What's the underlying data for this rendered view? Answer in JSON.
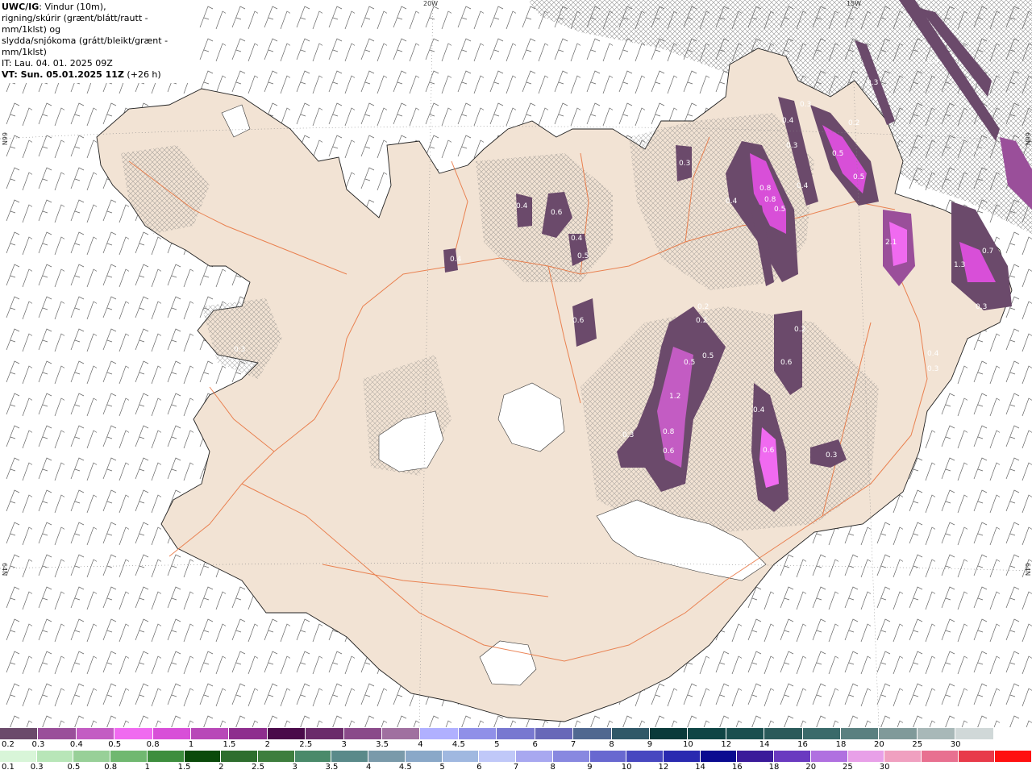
{
  "title": {
    "model": "UWC/IG",
    "line1_rest": ": Vindur (10m),",
    "line2": "rigning/skúrir (grænt/blátt/rautt - mm/1klst) og",
    "line3": "slydda/snjókoma (grátt/bleikt/grænt - mm/1klst)",
    "it": "IT: Lau. 04. 01. 2025 09Z",
    "vt_label": "VT: Sun. 05.01.2025 11Z",
    "vt_offset": " (+26 h)"
  },
  "coordinates": {
    "top_20w": "20W",
    "top_15w": "15W",
    "left_66n": "66N",
    "left_64n": "64N",
    "right_66n": "66N",
    "right_64n": "64N"
  },
  "snow_scale": {
    "colors": [
      "#6b4a6b",
      "#9a4f9a",
      "#c35cc3",
      "#f06af0",
      "#d84fd8",
      "#b848b8",
      "#8e2e8e",
      "#4a0a4a",
      "#6a2a6a",
      "#8a4a8a",
      "#a070a0",
      "#b0b0ff",
      "#9090e8",
      "#7878d0",
      "#6868b8",
      "#506890",
      "#305868",
      "#0a3a3a",
      "#0f4545",
      "#1a4f4f",
      "#2a5a5a",
      "#3a6a6a",
      "#5a8080",
      "#809a9a",
      "#a8b8b8",
      "#d0d8d8",
      "#ffffff"
    ],
    "labels": [
      "0.2",
      "0.3",
      "0.4",
      "0.5",
      "0.8",
      "1",
      "1.5",
      "2",
      "2.5",
      "3",
      "3.5",
      "4",
      "4.5",
      "5",
      "6",
      "7",
      "8",
      "9",
      "10",
      "12",
      "14",
      "16",
      "18",
      "20",
      "25",
      "30"
    ]
  },
  "rain_scale": {
    "colors": [
      "#d8f5d8",
      "#b8e6b8",
      "#98d098",
      "#70b870",
      "#3e8e3e",
      "#0a4a0a",
      "#2e6e2e",
      "#3e7e3e",
      "#4a8a6a",
      "#5a8a8a",
      "#7a9aaa",
      "#8aa8c8",
      "#a0b8e0",
      "#c0c8f8",
      "#a8a8f0",
      "#8888e0",
      "#6868d0",
      "#4848c0",
      "#2a2ab0",
      "#0a0a90",
      "#3a1a9a",
      "#6a3ac0",
      "#b070e0",
      "#e8a0e8",
      "#f0a0c0",
      "#e87090",
      "#e83a4a",
      "#ff1010"
    ],
    "labels": [
      "0.1",
      "0.3",
      "0.5",
      "0.8",
      "1",
      "1.5",
      "2",
      "2.5",
      "3",
      "3.5",
      "4",
      "4.5",
      "5",
      "6",
      "7",
      "8",
      "9",
      "10",
      "12",
      "14",
      "16",
      "18",
      "20",
      "25",
      "30"
    ]
  },
  "snow_values": [
    "0.4",
    "0.6",
    "0.4",
    "0.5",
    "0.3",
    "0.4",
    "0.6",
    "0.5",
    "0.6",
    "0.4",
    "0.3",
    "0.4",
    "0.8",
    "0.8",
    "0.4",
    "0.3",
    "0.5",
    "0.5",
    "0.2",
    "2.1",
    "1.3",
    "0.7",
    "0.3",
    "0.2",
    "0.2",
    "0.5",
    "0.5",
    "1.2",
    "0.3",
    "0.8",
    "0.6",
    "0.4",
    "0.6",
    "0.3",
    "0.2",
    "0.4",
    "0.3",
    "0.3",
    "0.3",
    "0.3",
    "0.4",
    "0.3"
  ]
}
